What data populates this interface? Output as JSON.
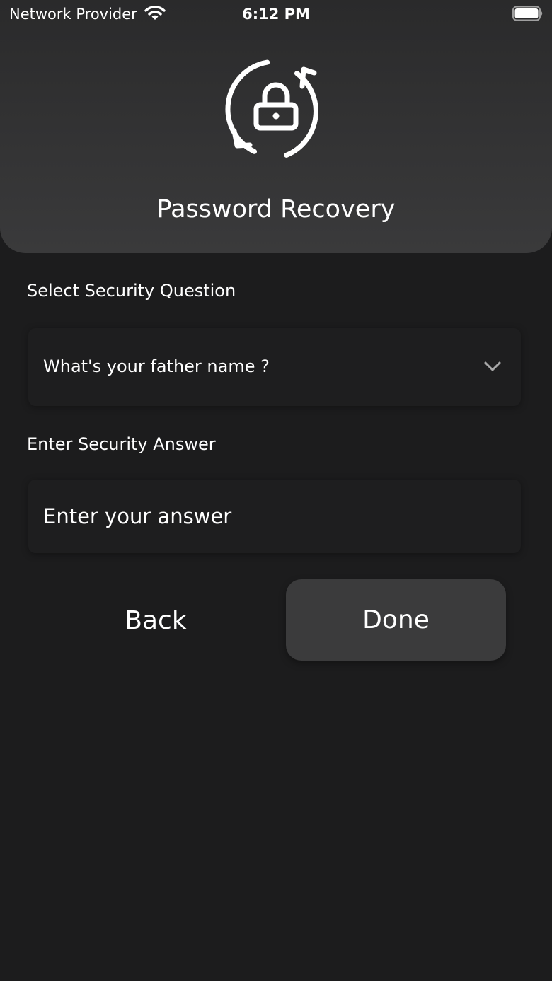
{
  "status_bar": {
    "carrier": "Network Provider",
    "time": "6:12 PM",
    "wifi_icon": "wifi-icon",
    "battery_icon": "battery-full-icon"
  },
  "header": {
    "icon": "lock-refresh-icon",
    "title": "Password Recovery"
  },
  "form": {
    "question_label": "Select Security Question",
    "question_selected": "What's your father name ?",
    "dropdown_icon": "chevron-down-icon",
    "answer_label": "Enter Security Answer",
    "answer_value": "",
    "answer_placeholder": "Enter your answer"
  },
  "actions": {
    "back_label": "Back",
    "done_label": "Done"
  },
  "colors": {
    "background": "#1c1c1d",
    "header": "#333334",
    "field": "#1e1e1f",
    "primary_button": "#3b3b3c",
    "text": "#ffffff"
  }
}
